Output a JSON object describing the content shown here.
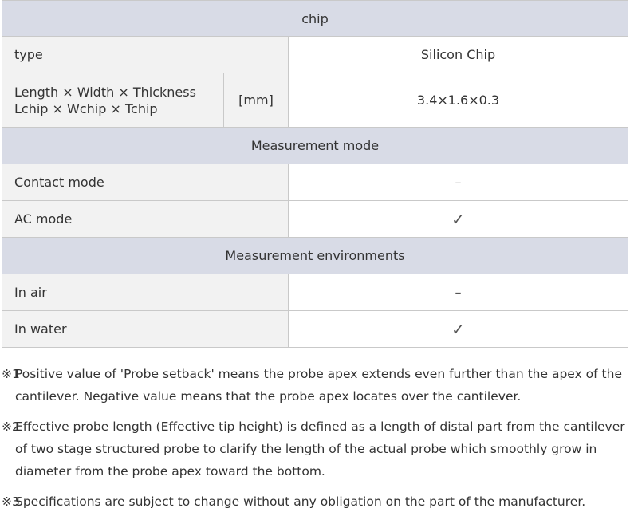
{
  "table": {
    "chip_header": "chip",
    "type_label": "type",
    "type_value": "Silicon Chip",
    "dimension_label": "Length × Width × Thickness",
    "dimension_sublabel": "Lchip × Wchip × Tchip",
    "dimension_unit": "[mm]",
    "dimension_value": "3.4×1.6×0.3",
    "mode_header": "Measurement mode",
    "contact_label": "Contact mode",
    "contact_value": "–",
    "ac_label": "AC mode",
    "ac_value": "✓",
    "env_header": "Measurement environments",
    "air_label": "In air",
    "air_value": "–",
    "water_label": "In water",
    "water_value": "✓"
  },
  "notes": [
    {
      "mark": "※1",
      "text": "Positive value of 'Probe setback' means the probe apex extends even further than the apex of the cantilever. Negative value means that the probe apex locates over the cantilever."
    },
    {
      "mark": "※2",
      "text": "Effective probe length (Effective tip height) is defined as a length of distal part from the cantilever of two stage structured probe to clarify the length of the actual probe which smoothly grow in diameter from the probe apex toward the bottom."
    },
    {
      "mark": "※3",
      "text": "Specifications are subject to change without any obligation on the part of the manufacturer."
    }
  ]
}
